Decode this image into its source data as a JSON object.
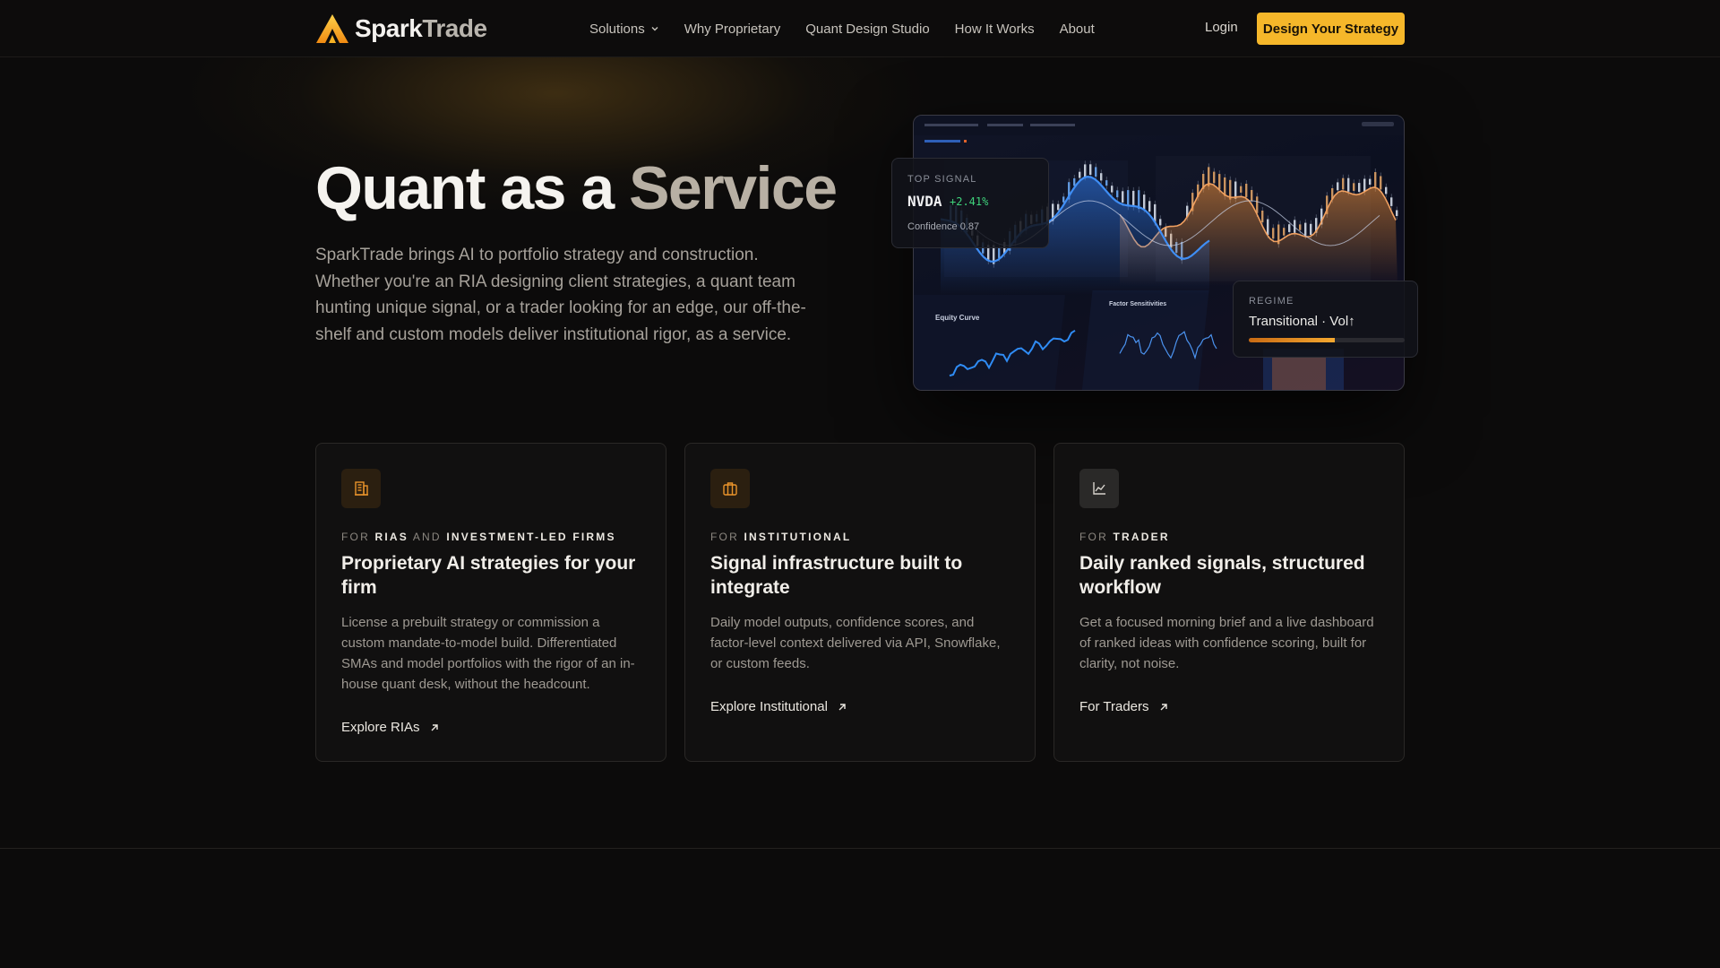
{
  "brand": {
    "name_a": "Spark",
    "name_b": "Trade",
    "accent": "#f5b72a"
  },
  "nav": {
    "links": [
      {
        "label": "Solutions",
        "has_dropdown": true
      },
      {
        "label": "Why Proprietary"
      },
      {
        "label": "Quant Design Studio"
      },
      {
        "label": "How It Works"
      },
      {
        "label": "About"
      }
    ],
    "login": "Login",
    "cta": "Design Your Strategy"
  },
  "hero": {
    "title_main": "Quant as a ",
    "title_accent": "Service",
    "description": "SparkTrade brings AI to portfolio strategy and construction. Whether you're an RIA designing client strategies, a quant team hunting unique signal, or a trader looking for an edge, our off-the-shelf and custom models deliver institutional rigor, as a service."
  },
  "dashboard": {
    "signal": {
      "label": "TOP SIGNAL",
      "ticker": "NVDA",
      "change": "+2.41%",
      "confidence": "Confidence 0.87"
    },
    "regime": {
      "label": "REGIME",
      "value": "Transitional · Vol↑",
      "level": 0.55
    },
    "panel_labels": {
      "equity": "Equity Curve",
      "factor": "Factor Sensitivities"
    }
  },
  "cards": [
    {
      "icon": "building-icon",
      "eyebrow_for": "For",
      "eyebrow_a": "RIAs",
      "eyebrow_and": "and",
      "eyebrow_b": "Investment-Led Firms",
      "title": "Proprietary AI strategies for your firm",
      "description": "License a prebuilt strategy or commission a custom mandate-to-model build. Differentiated SMAs and model portfolios with the rigor of an in-house quant desk, without the headcount.",
      "link": "Explore RIAs"
    },
    {
      "icon": "briefcase-icon",
      "eyebrow_for": "For",
      "eyebrow_a": "Institutional",
      "title": "Signal infrastructure built to integrate",
      "description": "Daily model outputs, confidence scores, and factor-level context delivered via API, Snowflake, or custom feeds.",
      "link": "Explore Institutional"
    },
    {
      "icon": "line-chart-icon",
      "eyebrow_for": "For",
      "eyebrow_a": "Trader",
      "title": "Daily ranked signals, structured workflow",
      "description": "Get a focused morning brief and a live dashboard of ranked ideas with confidence scoring, built for clarity, not noise.",
      "link": "For Traders"
    }
  ]
}
